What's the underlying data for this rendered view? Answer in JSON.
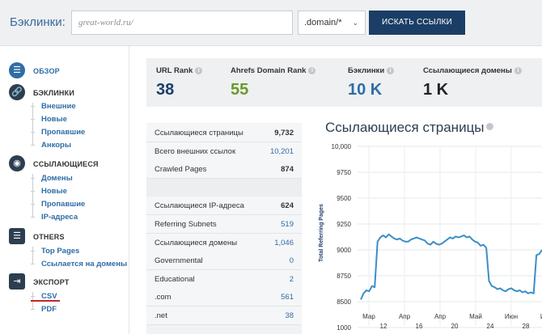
{
  "search": {
    "label": "Бэклинки:",
    "placeholder": "great-world.ru/",
    "mode": ".domain/*",
    "button": "ИСКАТЬ ССЫЛКИ"
  },
  "sidebar": {
    "overview": "ОБЗОР",
    "backlinks": {
      "title": "БЭКЛИНКИ",
      "items": [
        "Внешние",
        "Новые",
        "Пропавшие",
        "Анкоры"
      ]
    },
    "referring": {
      "title": "ССЫЛАЮЩИЕСЯ",
      "items": [
        "Домены",
        "Новые",
        "Пропавшие",
        "IP-адреса"
      ]
    },
    "others": {
      "title": "OTHERS",
      "items": [
        "Top Pages",
        "Ссылается на домены"
      ]
    },
    "export": {
      "title": "ЭКСПОРТ",
      "items": [
        "CSV",
        "PDF"
      ]
    }
  },
  "metrics": [
    {
      "label": "URL Rank",
      "value": "38",
      "color": "#1b3e66"
    },
    {
      "label": "Ahrefs Domain Rank",
      "value": "55",
      "color": "#6a9a2c"
    },
    {
      "label": "Бэклинки",
      "value": "10 K",
      "color": "#2f6da6"
    },
    {
      "label": "Ссылающиеся домены",
      "value": "1 K",
      "color": "#222222"
    }
  ],
  "stats": [
    {
      "label": "Ссылающиеся страницы",
      "value": "9,732",
      "style": "bold"
    },
    {
      "label": "Всего внешних ссылок",
      "value": "10,201",
      "style": "link"
    },
    {
      "label": "Crawled Pages",
      "value": "874",
      "style": "bold"
    },
    {
      "label": "",
      "value": "",
      "style": ""
    },
    {
      "label": "Ссылающиеся IP-адреса",
      "value": "624",
      "style": "bold"
    },
    {
      "label": "Referring Subnets",
      "value": "519",
      "style": "link"
    },
    {
      "label": "Ссылающиеся домены",
      "value": "1,046",
      "style": "link"
    },
    {
      "label": "Governmental",
      "value": "0",
      "style": "link"
    },
    {
      "label": "Educational",
      "value": "2",
      "style": "link"
    },
    {
      "label": ".com",
      "value": "561",
      "style": "link"
    },
    {
      "label": ".net",
      "value": "38",
      "style": "link"
    }
  ],
  "chart_data": {
    "type": "line",
    "title": "Ссылающиеся страницы",
    "ylabel": "Total Referring Pages",
    "ylim": [
      8500,
      10000
    ],
    "yticks": [
      "10,000",
      "9750",
      "9500",
      "9250",
      "9000",
      "8750",
      "8500",
      "1000"
    ],
    "xticks_month": [
      "Мар",
      "Апр",
      "Апр",
      "Май",
      "Июн",
      "Июл"
    ],
    "xticks_day": [
      "12",
      "16",
      "20",
      "24",
      "28",
      "32"
    ],
    "color": "#3a8fc8",
    "values": [
      8520,
      8580,
      8610,
      8600,
      8650,
      8640,
      9080,
      9120,
      9140,
      9120,
      9150,
      9130,
      9110,
      9100,
      9110,
      9090,
      9080,
      9080,
      9100,
      9110,
      9120,
      9110,
      9100,
      9090,
      9060,
      9050,
      9080,
      9060,
      9050,
      9060,
      9080,
      9100,
      9120,
      9110,
      9130,
      9120,
      9130,
      9140,
      9120,
      9130,
      9100,
      9080,
      9070,
      9040,
      9050,
      9020,
      8700,
      8650,
      8640,
      8620,
      8630,
      8610,
      8600,
      8620,
      8630,
      8610,
      8600,
      8610,
      8590,
      8600,
      8580,
      8590,
      8580,
      8950,
      8960,
      9000
    ]
  }
}
